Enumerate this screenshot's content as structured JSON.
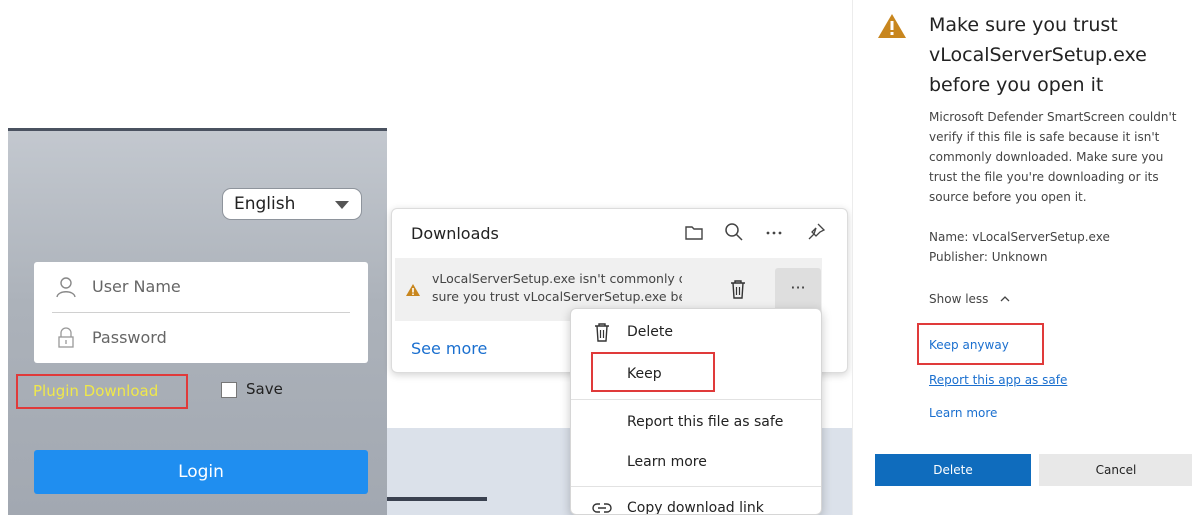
{
  "login": {
    "language": "English",
    "username_placeholder": "User Name",
    "password_placeholder": "Password",
    "plugin_download": "Plugin Download",
    "save_label": "Save",
    "login_button": "Login"
  },
  "downloads": {
    "title": "Downloads",
    "item_line1": "vLocalServerSetup.exe isn't commonly d",
    "item_line2": "sure you trust vLocalServerSetup.exe bé",
    "more_glyph": "···",
    "see_more": "See more"
  },
  "context_menu": {
    "delete": "Delete",
    "keep": "Keep",
    "report": "Report this file as safe",
    "learn": "Learn more",
    "copy": "Copy download link"
  },
  "smartscreen": {
    "title": "Make sure you trust vLocalServerSetup.exe before you open it",
    "description": "Microsoft Defender SmartScreen couldn't verify if this file is safe because it isn't commonly downloaded. Make sure you trust the file you're downloading or its source before you open it.",
    "name": "Name: vLocalServerSetup.exe",
    "publisher": "Publisher: Unknown",
    "show_less": "Show less",
    "keep_anyway": "Keep anyway",
    "report": "Report this app as safe",
    "learn_more": "Learn more",
    "delete_button": "Delete",
    "cancel_button": "Cancel"
  },
  "colors": {
    "accent_blue": "#1f8ef0",
    "highlight_red": "#e03a3a",
    "plugin_yellow": "#f0e84a",
    "warning_amber": "#c8861e"
  }
}
